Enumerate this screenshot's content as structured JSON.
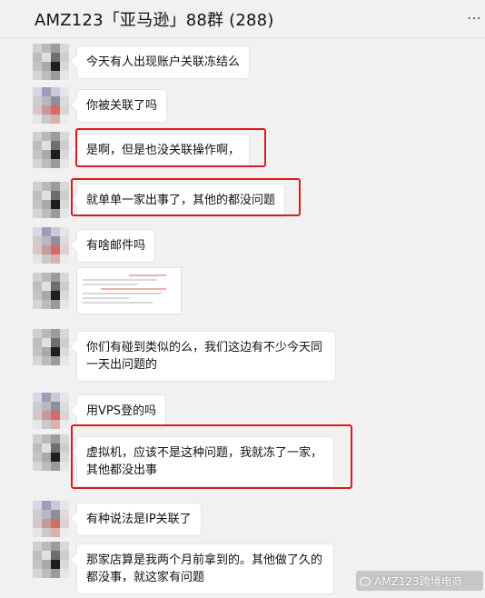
{
  "header": {
    "title": "AMZ123「亚马逊」88群 (288)",
    "more": "⋯"
  },
  "messages": [
    {
      "text": "今天有人出现账户关联冻结么",
      "highlighted": false
    },
    {
      "text": "你被关联了吗",
      "highlighted": false
    },
    {
      "text": "是啊，但是也没关联操作啊，",
      "highlighted": true
    },
    {
      "text": "就单单一家出事了，其他的都没问题",
      "highlighted": true
    },
    {
      "text": "有啥邮件吗",
      "highlighted": false
    },
    {
      "image": true
    },
    {
      "text": "你们有碰到类似的么，我们这边有不少今天同一天出问题的",
      "highlighted": false
    },
    {
      "text": "用VPS登的吗",
      "highlighted": false
    },
    {
      "text": "虚拟机，应该不是这种问题，我就冻了一家，其他都没出事",
      "highlighted": true
    },
    {
      "text": "有种说法是IP关联了",
      "highlighted": false
    },
    {
      "text": "那家店算是我两个月前拿到的。其他做了久的都没事，就这家有问题",
      "highlighted": false
    }
  ],
  "watermark": "AMZ123跨境电商",
  "colors": {
    "highlight": "#e0191c",
    "bubble": "#ffffff",
    "background": "#f1f1f1"
  }
}
